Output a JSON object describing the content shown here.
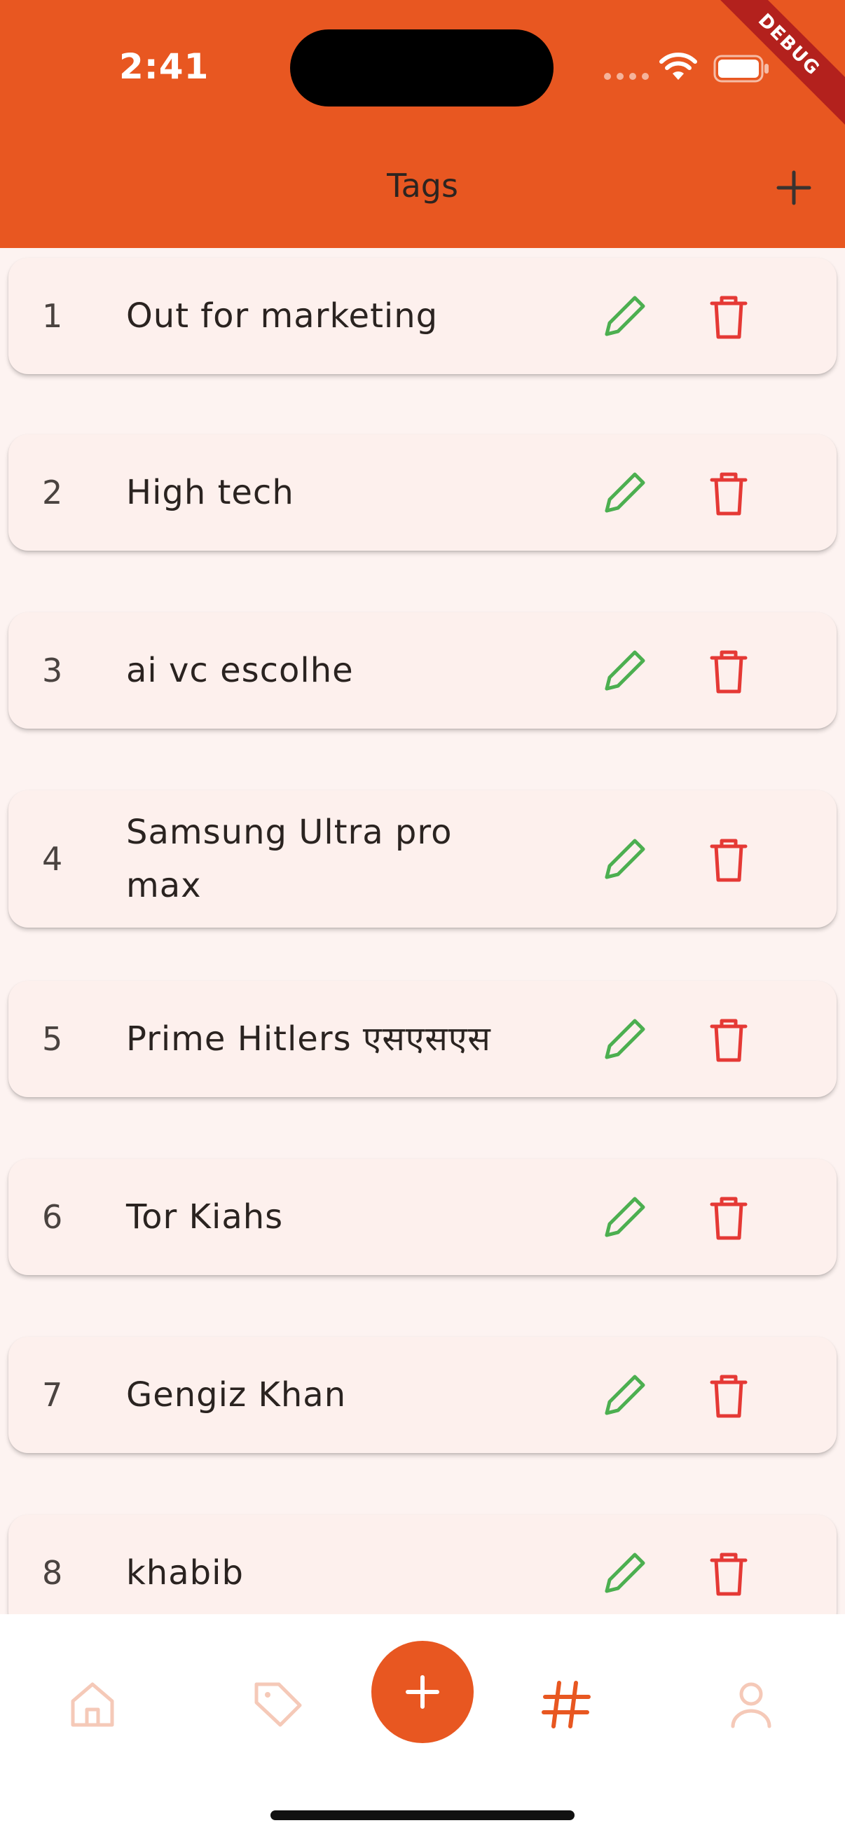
{
  "status_bar": {
    "time": "2:41"
  },
  "debug_banner": "DEBUG",
  "header": {
    "title": "Tags"
  },
  "tags": [
    {
      "number": "1",
      "name": "Out for marketing"
    },
    {
      "number": "2",
      "name": "High tech"
    },
    {
      "number": "3",
      "name": "ai vc escolhe"
    },
    {
      "number": "4",
      "name": "Samsung Ultra pro max"
    },
    {
      "number": "5",
      "name": "Prime Hitlers एसएसएस"
    },
    {
      "number": "6",
      "name": "Tor Kiahs"
    },
    {
      "number": "7",
      "name": "Gengiz Khan"
    },
    {
      "number": "8",
      "name": "khabib"
    }
  ],
  "icons": {
    "edit": "pencil-icon",
    "delete": "trash-icon",
    "nav": [
      "home-icon",
      "tag-icon",
      "plus-icon",
      "hashtag-icon",
      "person-icon"
    ]
  },
  "nav": {
    "active": "hashtag"
  },
  "colors": {
    "primary": "#e85721",
    "edit": "#4caf50",
    "delete": "#e53935",
    "nav_inactive": "#f5c9b8",
    "card_bg": "#fdf0ed"
  }
}
